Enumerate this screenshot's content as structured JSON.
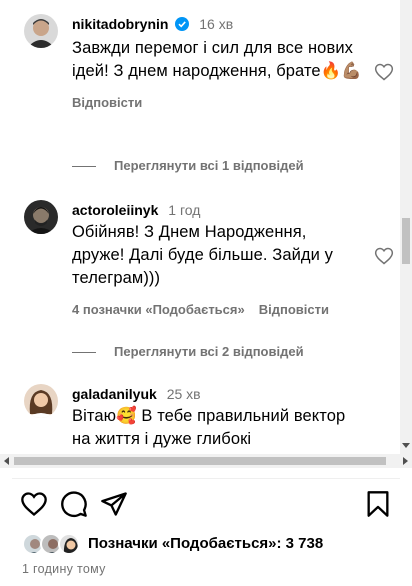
{
  "comments": [
    {
      "username": "nikitadobrynin",
      "verified": true,
      "time": "16 хв",
      "text": "Завжди перемог і сил для все нових ідей! З днем народження, брате🔥💪🏽",
      "actions": {
        "reply": "Відповісти"
      },
      "view_replies": "Переглянути всі 1 відповідей"
    },
    {
      "username": "actoroleiinyk",
      "verified": false,
      "time": "1 год",
      "text": "Обійняв! З Днем Народження, друже! Далі буде більше. Зайди у телеграм)))",
      "actions": {
        "likes": "4 позначки «Подобається»",
        "reply": "Відповісти"
      },
      "view_replies": "Переглянути всі 2 відповідей"
    },
    {
      "username": "galadanilyuk",
      "verified": false,
      "time": "25 хв",
      "text": "Вітаю🥰 В тебе правильний вектор на життя і дуже глибокі"
    }
  ],
  "likes": {
    "text": "Позначки «Подобається»: 3 738"
  },
  "post_time": "1 годину тому",
  "colors": {
    "secondary_text": "#737373",
    "verified": "#0095f6",
    "scrollbar": "#c1c1c1"
  }
}
